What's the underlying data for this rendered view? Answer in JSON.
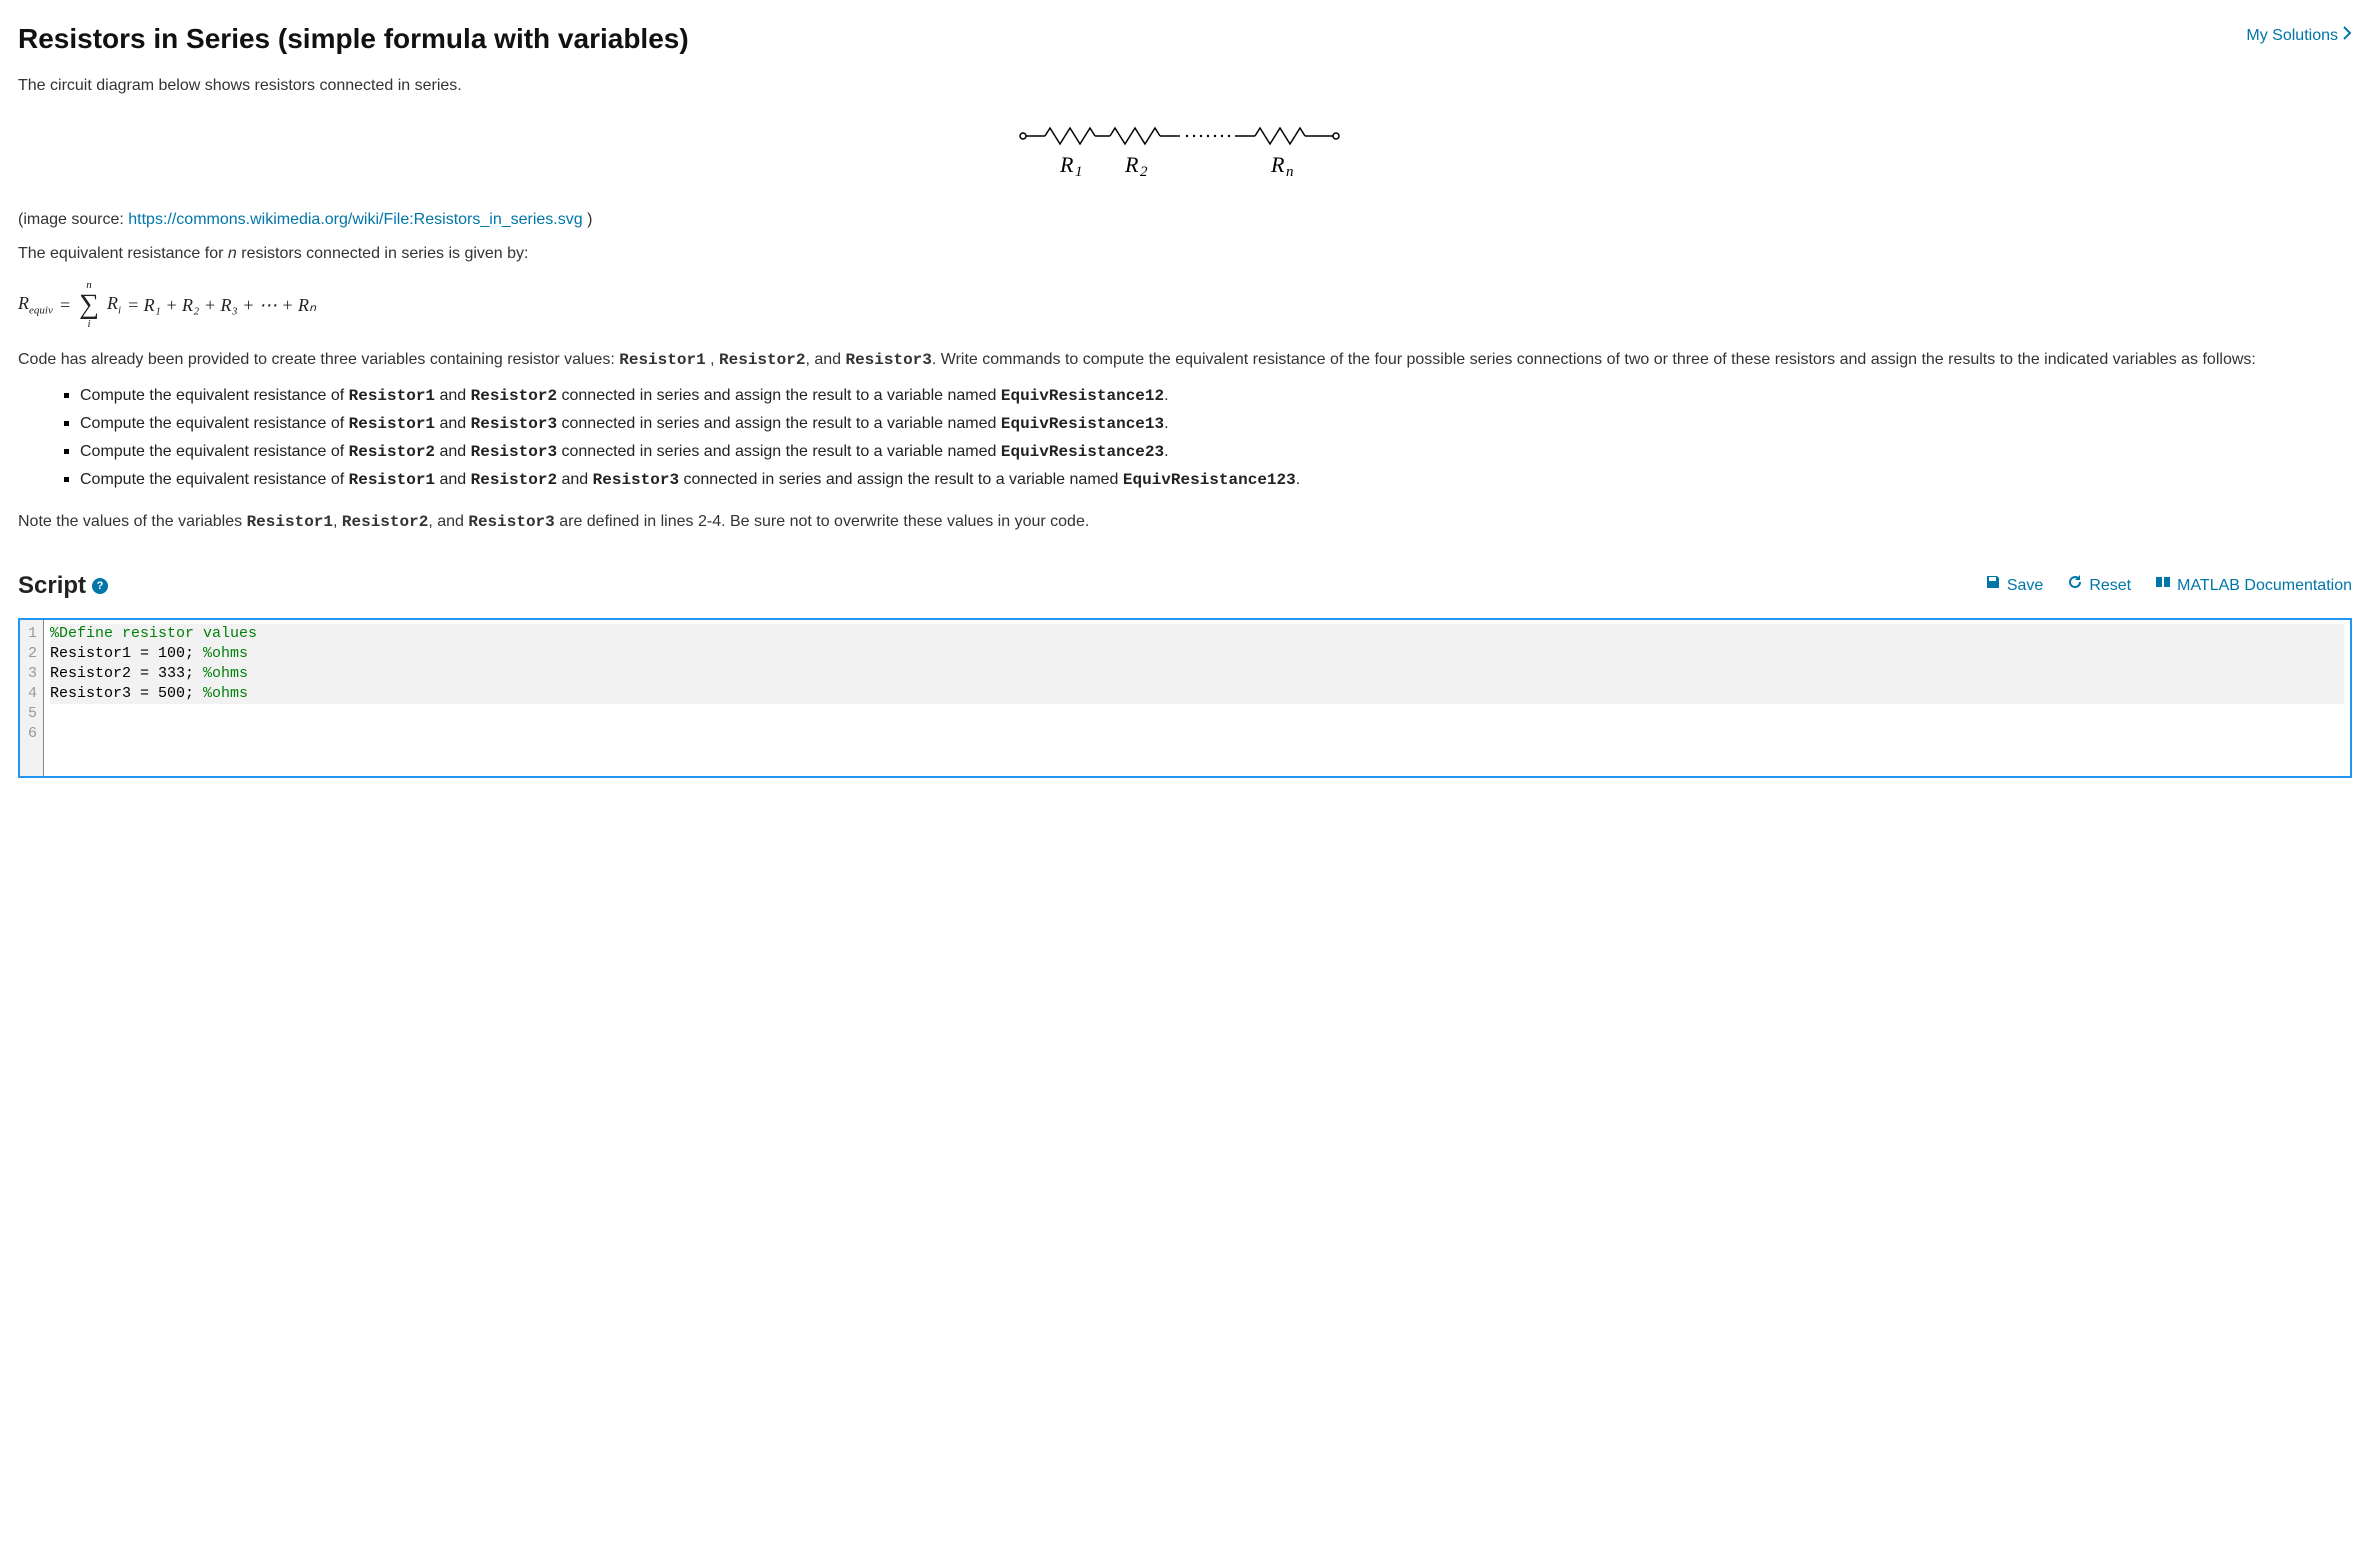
{
  "header": {
    "title": "Resistors in Series (simple formula with variables)",
    "my_solutions": "My Solutions"
  },
  "intro": "The circuit diagram below shows resistors connected in series.",
  "diagram": {
    "labels": [
      "R",
      "1",
      "R",
      "2",
      "R",
      "n"
    ]
  },
  "image_source": {
    "prefix": "(image source: ",
    "url": "https://commons.wikimedia.org/wiki/File:Resistors_in_series.svg",
    "suffix": " )"
  },
  "equiv_sentence": {
    "pre": "The equivalent resistance for ",
    "var": "n",
    "post": " resistors connected in series is given by:"
  },
  "formula": {
    "lhs": "R",
    "lhs_sub": "equiv",
    "eq": " = ",
    "sum_top": "n",
    "sum_bottom": "i",
    "sum_body": "R",
    "sum_body_sub": "i",
    "rhs": " = R₁ + R₂ + R₃ + ⋯ + Rₙ"
  },
  "paragraph2": {
    "p1": "Code has already been provided to create three variables containing resistor values: ",
    "r1": "Resistor1",
    "c1": " , ",
    "r2": "Resistor2",
    "c2": ", and ",
    "r3": "Resistor3",
    "t": ". Write commands to compute the equivalent resistance of the four possible series connections of two or three of these resistors and assign the results to the indicated variables as follows:"
  },
  "bullets": [
    {
      "t1": "Compute the equivalent resistance of ",
      "b1": "Resistor1",
      "t2": " and ",
      "b2": "Resistor2",
      "t3": " connected in series and assign the result to a variable named ",
      "b3": "EquivResistance12",
      "t4": "."
    },
    {
      "t1": "Compute the equivalent resistance of ",
      "b1": "Resistor1",
      "t2": " and ",
      "b2": "Resistor3",
      "t3": " connected in series and assign the result to a variable named ",
      "b3": "EquivResistance13",
      "t4": "."
    },
    {
      "t1": "Compute the equivalent resistance of ",
      "b1": "Resistor2",
      "t2": " and ",
      "b2": "Resistor3",
      "t3": " connected in series and assign the result to a variable named ",
      "b3": "EquivResistance23",
      "t4": "."
    },
    {
      "t1": "Compute the equivalent resistance of ",
      "b1": "Resistor1",
      "t2": " and ",
      "b2": "Resistor2",
      "t2b": " and ",
      "b2b": "Resistor3",
      "t3": " connected in series and assign the result to a variable named ",
      "b3": "EquivResistance123",
      "t4": "."
    }
  ],
  "note": {
    "t1": "Note the values of the variables ",
    "b1": "Resistor1",
    "c1": ", ",
    "b2": "Resistor2",
    "c2": ", and ",
    "b3": "Resistor3",
    "t2": " are defined in lines 2-4.  Be sure not to overwrite these values in your code."
  },
  "script": {
    "title": "Script",
    "help": "?",
    "save": "Save",
    "reset": "Reset",
    "docs": "MATLAB Documentation"
  },
  "code_lines": [
    {
      "n": "1",
      "shaded": true,
      "segments": [
        {
          "cls": "comment",
          "text": "%Define resistor values"
        }
      ]
    },
    {
      "n": "2",
      "shaded": true,
      "segments": [
        {
          "cls": "plain",
          "text": "Resistor1 = 100; "
        },
        {
          "cls": "comment",
          "text": "%ohms"
        }
      ]
    },
    {
      "n": "3",
      "shaded": true,
      "segments": [
        {
          "cls": "plain",
          "text": "Resistor2 = 333; "
        },
        {
          "cls": "comment",
          "text": "%ohms"
        }
      ]
    },
    {
      "n": "4",
      "shaded": true,
      "segments": [
        {
          "cls": "plain",
          "text": "Resistor3 = 500; "
        },
        {
          "cls": "comment",
          "text": "%ohms"
        }
      ]
    },
    {
      "n": "5",
      "shaded": false,
      "segments": []
    },
    {
      "n": "6",
      "shaded": false,
      "segments": []
    }
  ]
}
